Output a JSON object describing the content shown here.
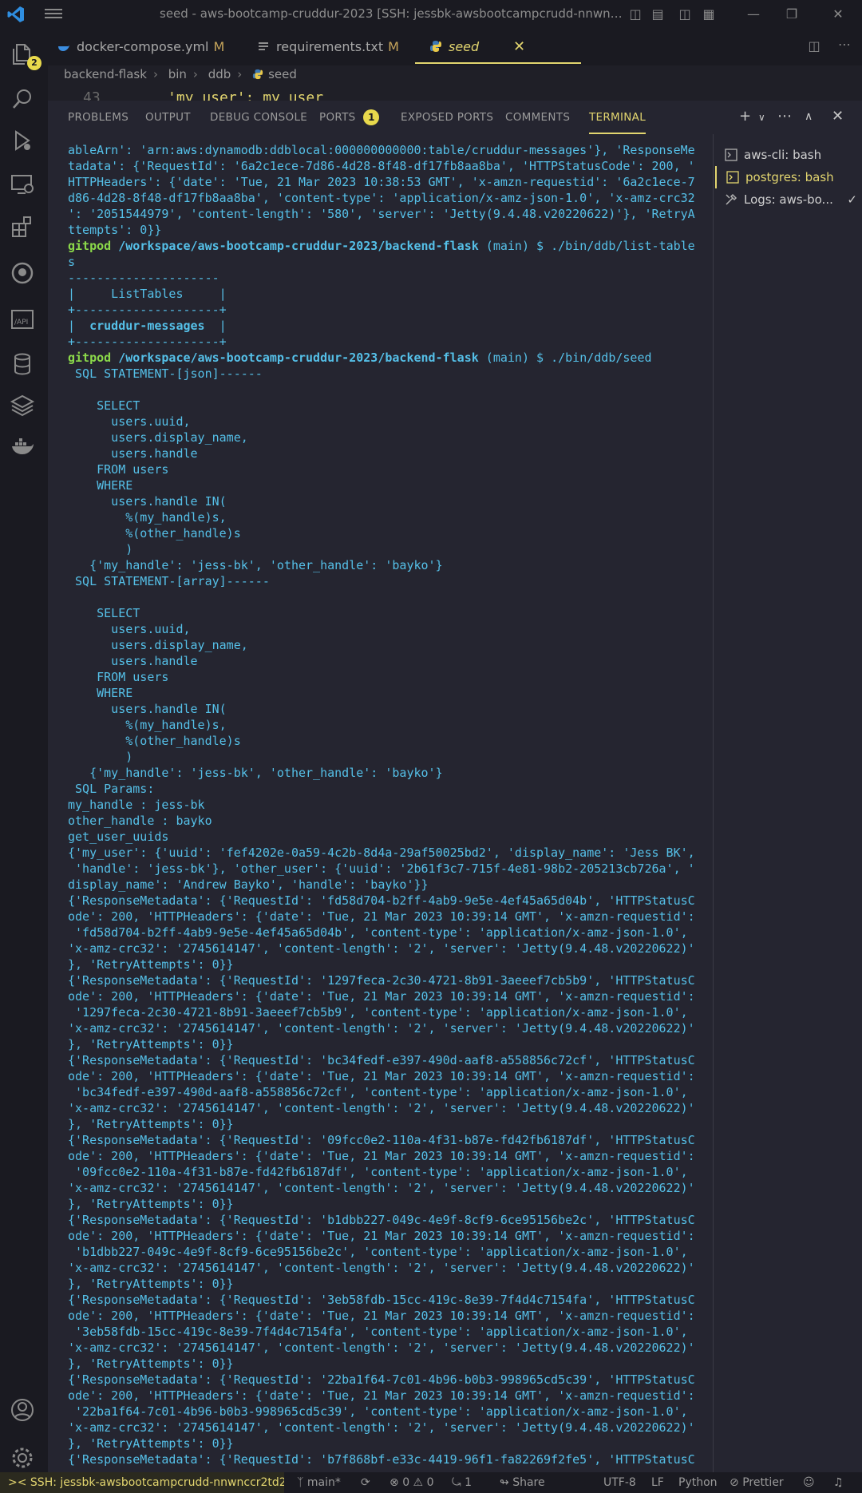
{
  "window": {
    "title": "seed - aws-bootcamp-cruddur-2023 [SSH: jessbk-awsbootcampcrudd-nnwnccr2td2..."
  },
  "activity": {
    "explorer_badge": "2"
  },
  "tabs": [
    {
      "label": "docker-compose.yml",
      "modified": "M"
    },
    {
      "label": "requirements.txt",
      "modified": "M"
    },
    {
      "label": "seed",
      "close": "✕"
    }
  ],
  "breadcrumb": [
    "backend-flask",
    "bin",
    "ddb",
    "seed"
  ],
  "editor_peek": {
    "line_number": "43",
    "code": "'my_user': my_user"
  },
  "panel": {
    "tabs": [
      "PROBLEMS",
      "OUTPUT",
      "DEBUG CONSOLE",
      "PORTS",
      "EXPOSED PORTS",
      "COMMENTS",
      "TERMINAL"
    ],
    "ports_badge": "1",
    "active_tab": "TERMINAL"
  },
  "terminals": [
    {
      "label": "aws-cli: bash"
    },
    {
      "label": "postgres: bash"
    },
    {
      "label": "Logs: aws-bo..."
    }
  ],
  "terminal": {
    "prompt": {
      "user": "gitpod",
      "path": "/workspace/aws-bootcamp-cruddur-2023/backend-flask",
      "branch": "(main) $"
    },
    "lines_head": [
      "ableArn': 'arn:aws:dynamodb:ddblocal:000000000000:table/cruddur-messages'}, 'ResponseMe",
      "tadata': {'RequestId': '6a2c1ece-7d86-4d28-8f48-df17fb8aa8ba', 'HTTPStatusCode': 200, '",
      "HTTPHeaders': {'date': 'Tue, 21 Mar 2023 10:38:53 GMT', 'x-amzn-requestid': '6a2c1ece-7",
      "d86-4d28-8f48-df17fb8aa8ba', 'content-type': 'application/x-amz-json-1.0', 'x-amz-crc32",
      "': '2051544979', 'content-length': '580', 'server': 'Jetty(9.4.48.v20220622)'}, 'RetryA",
      "ttempts': 0}}"
    ],
    "cmd1": "./bin/ddb/list-table",
    "cmd1_wrap": "s",
    "table": {
      "border": "---------------------",
      "header": "|     ListTables     |",
      "sep": "+--------------------+",
      "row_left": "|  ",
      "row_value": "cruddur-messages",
      "row_right": "  |"
    },
    "cmd2": "./bin/ddb/seed",
    "lines_body": [
      " SQL STATEMENT-[json]------",
      "",
      "    SELECT",
      "      users.uuid,",
      "      users.display_name,",
      "      users.handle",
      "    FROM users",
      "    WHERE",
      "      users.handle IN(",
      "        %(my_handle)s,",
      "        %(other_handle)s",
      "        )",
      "   {'my_handle': 'jess-bk', 'other_handle': 'bayko'}",
      " SQL STATEMENT-[array]------",
      "",
      "    SELECT",
      "      users.uuid,",
      "      users.display_name,",
      "      users.handle",
      "    FROM users",
      "    WHERE",
      "      users.handle IN(",
      "        %(my_handle)s,",
      "        %(other_handle)s",
      "        )",
      "   {'my_handle': 'jess-bk', 'other_handle': 'bayko'}",
      " SQL Params:",
      "my_handle : jess-bk",
      "other_handle : bayko",
      "get_user_uuids",
      "{'my_user': {'uuid': 'fef4202e-0a59-4c2b-8d4a-29af50025bd2', 'display_name': 'Jess BK',",
      " 'handle': 'jess-bk'}, 'other_user': {'uuid': '2b61f3c7-715f-4e81-98b2-205213cb726a', '",
      "display_name': 'Andrew Bayko', 'handle': 'bayko'}}",
      "{'ResponseMetadata': {'RequestId': 'fd58d704-b2ff-4ab9-9e5e-4ef45a65d04b', 'HTTPStatusC",
      "ode': 200, 'HTTPHeaders': {'date': 'Tue, 21 Mar 2023 10:39:14 GMT', 'x-amzn-requestid':",
      " 'fd58d704-b2ff-4ab9-9e5e-4ef45a65d04b', 'content-type': 'application/x-amz-json-1.0',",
      "'x-amz-crc32': '2745614147', 'content-length': '2', 'server': 'Jetty(9.4.48.v20220622)'",
      "}, 'RetryAttempts': 0}}",
      "{'ResponseMetadata': {'RequestId': '1297feca-2c30-4721-8b91-3aeeef7cb5b9', 'HTTPStatusC",
      "ode': 200, 'HTTPHeaders': {'date': 'Tue, 21 Mar 2023 10:39:14 GMT', 'x-amzn-requestid':",
      " '1297feca-2c30-4721-8b91-3aeeef7cb5b9', 'content-type': 'application/x-amz-json-1.0',",
      "'x-amz-crc32': '2745614147', 'content-length': '2', 'server': 'Jetty(9.4.48.v20220622)'",
      "}, 'RetryAttempts': 0}}",
      "{'ResponseMetadata': {'RequestId': 'bc34fedf-e397-490d-aaf8-a558856c72cf', 'HTTPStatusC",
      "ode': 200, 'HTTPHeaders': {'date': 'Tue, 21 Mar 2023 10:39:14 GMT', 'x-amzn-requestid':",
      " 'bc34fedf-e397-490d-aaf8-a558856c72cf', 'content-type': 'application/x-amz-json-1.0',",
      "'x-amz-crc32': '2745614147', 'content-length': '2', 'server': 'Jetty(9.4.48.v20220622)'",
      "}, 'RetryAttempts': 0}}",
      "{'ResponseMetadata': {'RequestId': '09fcc0e2-110a-4f31-b87e-fd42fb6187df', 'HTTPStatusC",
      "ode': 200, 'HTTPHeaders': {'date': 'Tue, 21 Mar 2023 10:39:14 GMT', 'x-amzn-requestid':",
      " '09fcc0e2-110a-4f31-b87e-fd42fb6187df', 'content-type': 'application/x-amz-json-1.0',",
      "'x-amz-crc32': '2745614147', 'content-length': '2', 'server': 'Jetty(9.4.48.v20220622)'",
      "}, 'RetryAttempts': 0}}",
      "{'ResponseMetadata': {'RequestId': 'b1dbb227-049c-4e9f-8cf9-6ce95156be2c', 'HTTPStatusC",
      "ode': 200, 'HTTPHeaders': {'date': 'Tue, 21 Mar 2023 10:39:14 GMT', 'x-amzn-requestid':",
      " 'b1dbb227-049c-4e9f-8cf9-6ce95156be2c', 'content-type': 'application/x-amz-json-1.0',",
      "'x-amz-crc32': '2745614147', 'content-length': '2', 'server': 'Jetty(9.4.48.v20220622)'",
      "}, 'RetryAttempts': 0}}",
      "{'ResponseMetadata': {'RequestId': '3eb58fdb-15cc-419c-8e39-7f4d4c7154fa', 'HTTPStatusC",
      "ode': 200, 'HTTPHeaders': {'date': 'Tue, 21 Mar 2023 10:39:14 GMT', 'x-amzn-requestid':",
      " '3eb58fdb-15cc-419c-8e39-7f4d4c7154fa', 'content-type': 'application/x-amz-json-1.0',",
      "'x-amz-crc32': '2745614147', 'content-length': '2', 'server': 'Jetty(9.4.48.v20220622)'",
      "}, 'RetryAttempts': 0}}",
      "{'ResponseMetadata': {'RequestId': '22ba1f64-7c01-4b96-b0b3-998965cd5c39', 'HTTPStatusC",
      "ode': 200, 'HTTPHeaders': {'date': 'Tue, 21 Mar 2023 10:39:14 GMT', 'x-amzn-requestid':",
      " '22ba1f64-7c01-4b96-b0b3-998965cd5c39', 'content-type': 'application/x-amz-json-1.0',",
      "'x-amz-crc32': '2745614147', 'content-length': '2', 'server': 'Jetty(9.4.48.v20220622)'",
      "}, 'RetryAttempts': 0}}",
      "{'ResponseMetadata': {'RequestId': 'b7f868bf-e33c-4419-96f1-fa82269f2fe5', 'HTTPStatusC"
    ]
  },
  "statusbar": {
    "remote": "SSH: jessbk-awsbootcampcrudd-nnwnccr2td2...",
    "branch": "main*",
    "errors": "0",
    "warnings": "0",
    "ports": "1",
    "share": "Share",
    "encoding": "UTF-8",
    "eol": "LF",
    "language": "Python",
    "formatter": "Prettier"
  },
  "colors": {
    "accent": "#e2d56f",
    "terminal_text": "#55c0e8",
    "prompt_user": "#8bd94a"
  }
}
